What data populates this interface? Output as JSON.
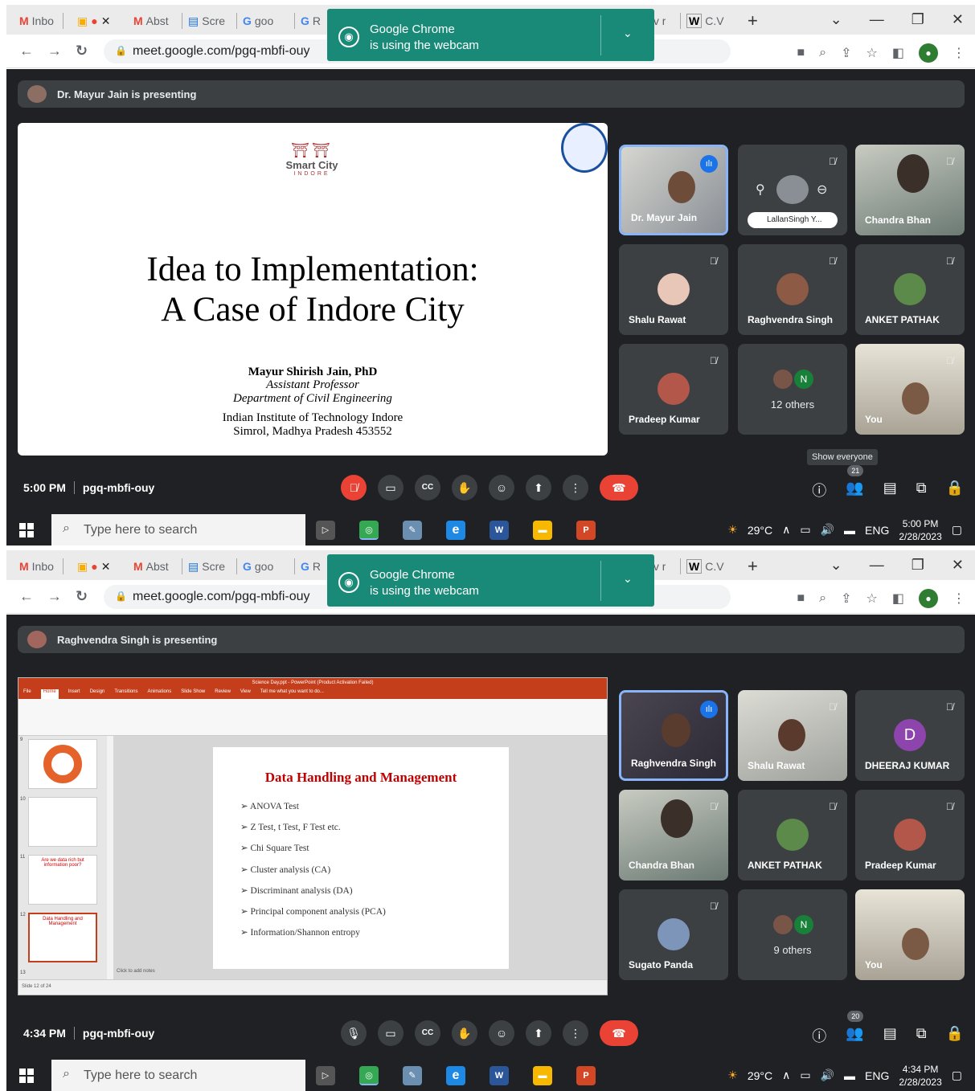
{
  "screens": [
    {
      "tabs": [
        "Inbo",
        "",
        "Abst",
        "Scre",
        "goo",
        "R",
        "",
        "",
        "",
        "",
        "",
        "cv r",
        "C.V"
      ],
      "url": "meet.google.com/pgq-mbfi-ouy",
      "notification": {
        "line1": "Google Chrome",
        "line2": "is using the webcam"
      },
      "presenting": "Dr. Mayur Jain is presenting",
      "slide": {
        "logo_text": "Smart City",
        "logo_sub": "INDORE",
        "title_line1": "Idea to Implementation:",
        "title_line2": "A Case of Indore City",
        "author": "Mayur Shirish Jain, PhD",
        "role": "Assistant Professor",
        "dept": "Department of Civil Engineering",
        "inst": "Indian Institute of Technology Indore",
        "addr": "Simrol, Madhya Pradesh 453552"
      },
      "participants": [
        {
          "name": "Dr. Mayur Jain"
        },
        {
          "name": "LallanSingh Y..."
        },
        {
          "name": "Chandra Bhan"
        },
        {
          "name": "Shalu Rawat"
        },
        {
          "name": "Raghvendra Singh"
        },
        {
          "name": "ANKET PATHAK"
        },
        {
          "name": "Pradeep Kumar"
        },
        {
          "name": "12 others",
          "badge": "N"
        },
        {
          "name": "You"
        }
      ],
      "tooltip": "Show everyone",
      "participant_count": "21",
      "meeting_time": "5:00 PM",
      "meeting_code": "pgq-mbfi-ouy",
      "taskbar": {
        "search": "Type here to search",
        "temp": "29°C",
        "lang": "ENG",
        "time": "5:00 PM",
        "date": "2/28/2023"
      }
    },
    {
      "tabs": [
        "Inbo",
        "",
        "Abst",
        "Scre",
        "goo",
        "R",
        "",
        "",
        "",
        "",
        "",
        "cv r",
        "C.V"
      ],
      "url": "meet.google.com/pgq-mbfi-ouy",
      "notification": {
        "line1": "Google Chrome",
        "line2": "is using the webcam"
      },
      "presenting": "Raghvendra Singh is presenting",
      "ppt": {
        "title": "Science Day.ppt - PowerPoint (Product Activation Failed)",
        "menu": [
          "File",
          "Home",
          "Insert",
          "Design",
          "Transitions",
          "Animations",
          "Slide Show",
          "Review",
          "View",
          "Tell me what you want to do..."
        ],
        "slide_title": "Data Handling and Management",
        "bullets": [
          "ANOVA Test",
          "Z Test, t Test, F Test etc.",
          "Chi Square Test",
          "Cluster analysis (CA)",
          "Discriminant analysis (DA)",
          "Principal component analysis (PCA)",
          "Information/Shannon entropy"
        ],
        "thumb_labels": [
          "9",
          "10",
          "11",
          "12",
          "13"
        ],
        "thumb11": "Are we data rich but information poor?",
        "thumb12": "Data Handling and Management",
        "notes": "Click to add notes",
        "status": "Slide 12 of 24"
      },
      "participants": [
        {
          "name": "Raghvendra Singh"
        },
        {
          "name": "Shalu Rawat"
        },
        {
          "name": "DHEERAJ KUMAR",
          "initial": "D"
        },
        {
          "name": "Chandra Bhan"
        },
        {
          "name": "ANKET PATHAK"
        },
        {
          "name": "Pradeep Kumar"
        },
        {
          "name": "Sugato Panda"
        },
        {
          "name": "9 others",
          "badge": "N"
        },
        {
          "name": "You"
        }
      ],
      "participant_count": "20",
      "meeting_time": "4:34 PM",
      "meeting_code": "pgq-mbfi-ouy",
      "taskbar": {
        "search": "Type here to search",
        "temp": "29°C",
        "lang": "ENG",
        "time": "4:34 PM",
        "date": "2/28/2023"
      }
    }
  ],
  "colors": {
    "meet_bg": "#202124",
    "tile_bg": "#3c4043",
    "end_call": "#ea4335",
    "notify": "#188a77",
    "active_border": "#8ab4f8"
  }
}
